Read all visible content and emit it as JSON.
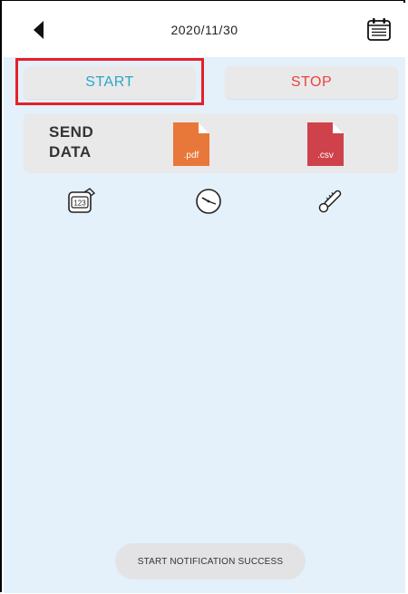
{
  "header": {
    "date": "2020/11/30",
    "back_icon": "back-arrow-icon",
    "calendar_icon": "calendar-icon"
  },
  "controls": {
    "start_label": "START",
    "stop_label": "STOP"
  },
  "send_data": {
    "label_line1": "SEND",
    "label_line2": "DATA",
    "pdf_label": ".pdf",
    "csv_label": ".csv"
  },
  "tools": [
    {
      "icon": "counter-123-icon"
    },
    {
      "icon": "clock-icon"
    },
    {
      "icon": "thermometer-icon"
    }
  ],
  "toast": {
    "message": "START NOTIFICATION SUCCESS"
  },
  "colors": {
    "background": "#e4f1fb",
    "start_text": "#2ea6c4",
    "stop_text": "#e8443a",
    "highlight": "#e6202a",
    "pdf": "#e8773a",
    "csv": "#cf424c"
  }
}
